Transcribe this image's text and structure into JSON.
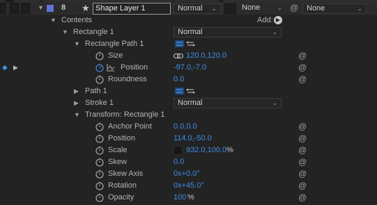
{
  "layer": {
    "index": "8",
    "name": "Shape Layer 1",
    "mode": "Normal",
    "trkmat": "None",
    "parent": "None"
  },
  "contents": {
    "label": "Contents",
    "add_label": "Add:"
  },
  "groups": {
    "rectangle1": {
      "label": "Rectangle 1",
      "blend": "Normal"
    },
    "rectangle_path1": {
      "label": "Rectangle Path 1"
    },
    "path1": {
      "label": "Path 1"
    },
    "stroke1": {
      "label": "Stroke 1",
      "blend": "Normal"
    },
    "transform": {
      "label": "Transform: Rectangle 1"
    }
  },
  "properties": {
    "size": {
      "label": "Size",
      "value": "120.0,120.0"
    },
    "position": {
      "label": "Position",
      "value": "-97.0,-7.0"
    },
    "roundness": {
      "label": "Roundness",
      "value": "0.0"
    },
    "anchor_point": {
      "label": "Anchor Point",
      "value": "0.0,0.0"
    },
    "t_position": {
      "label": "Position",
      "value": "114.0,-50.0"
    },
    "scale": {
      "label": "Scale",
      "value": "932.0,100.0",
      "unit": "%"
    },
    "skew": {
      "label": "Skew",
      "value": "0.0"
    },
    "skew_axis": {
      "label": "Skew Axis",
      "value": "0x+0.0°"
    },
    "rotation": {
      "label": "Rotation",
      "value": "0x+45.0°"
    },
    "opacity": {
      "label": "Opacity",
      "value": "100",
      "unit": "%"
    }
  },
  "colors": {
    "background": "#232323",
    "value_blue": "#3d8fe8",
    "label_color": "#b4b4b4",
    "layer_label_color": "#5d76d6"
  },
  "icons": [
    "stopwatch-icon",
    "graph-icon",
    "keyframe-diamond-icon",
    "expression-swirl-icon",
    "link-icon",
    "triangle-icon",
    "star-icon",
    "path-direction-icon"
  ]
}
